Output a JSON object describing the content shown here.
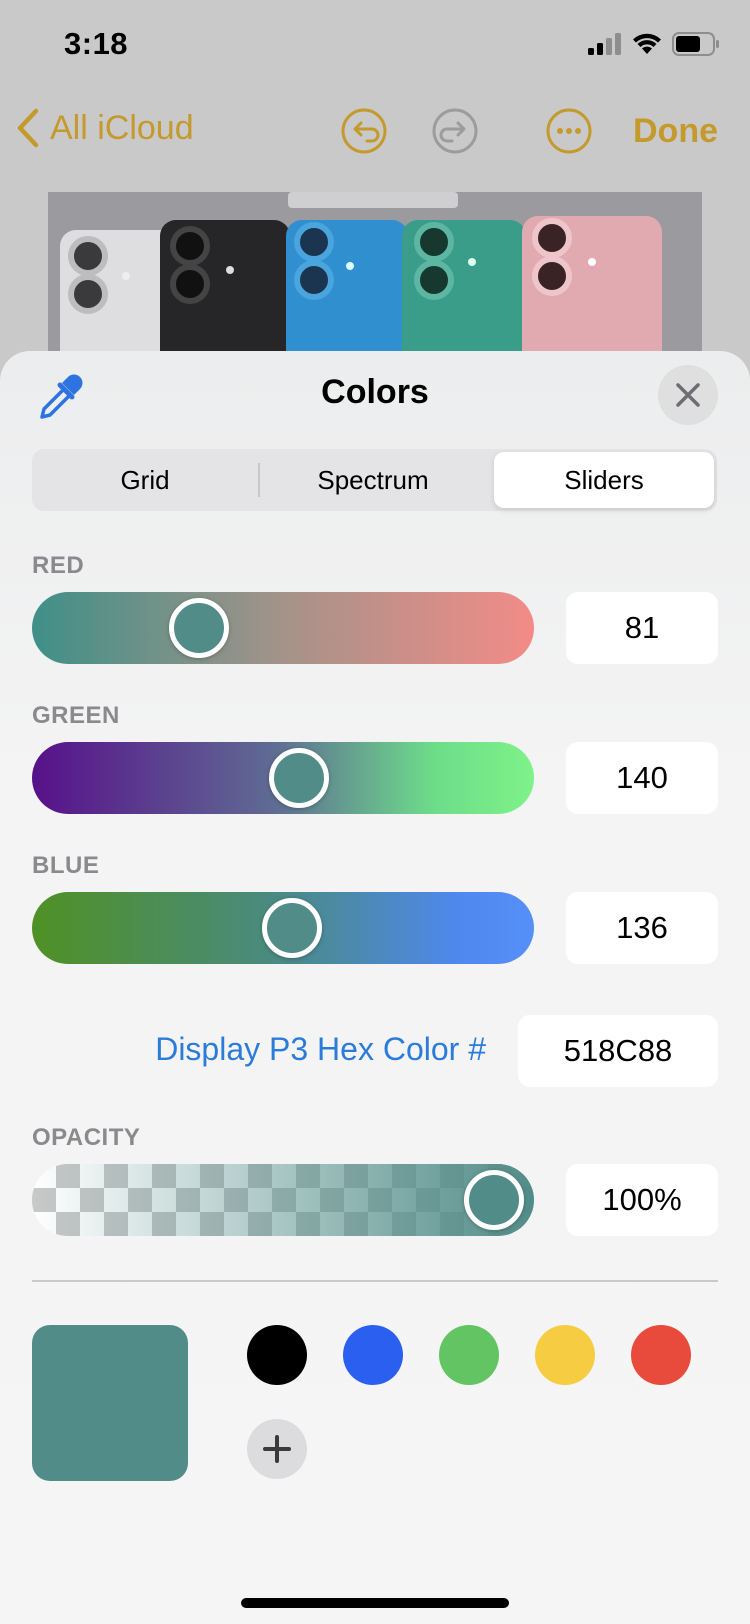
{
  "status_bar": {
    "time": "3:18"
  },
  "nav": {
    "back_label": "All iCloud",
    "done_label": "Done",
    "undo_icon": "undo-icon",
    "redo_icon": "redo-icon",
    "more_icon": "more-icon",
    "accent": "#c49a2c"
  },
  "sheet": {
    "title": "Colors",
    "tabs": [
      {
        "label": "Grid",
        "selected": false
      },
      {
        "label": "Spectrum",
        "selected": false
      },
      {
        "label": "Sliders",
        "selected": true
      }
    ],
    "sliders": {
      "red": {
        "label": "RED",
        "value": "81",
        "fraction": 0.318
      },
      "green": {
        "label": "GREEN",
        "value": "140",
        "fraction": 0.549
      },
      "blue": {
        "label": "BLUE",
        "value": "136",
        "fraction": 0.533
      }
    },
    "hex": {
      "label": "Display P3 Hex Color #",
      "value": "518C88"
    },
    "opacity": {
      "label": "OPACITY",
      "value": "100%",
      "fraction": 1.0
    },
    "current_color": "#518c88",
    "swatches": [
      {
        "name": "black",
        "color": "#000000"
      },
      {
        "name": "blue",
        "color": "#2a5ff0"
      },
      {
        "name": "green",
        "color": "#62c462"
      },
      {
        "name": "yellow",
        "color": "#f6cc42"
      },
      {
        "name": "red",
        "color": "#e84b3c"
      }
    ]
  }
}
